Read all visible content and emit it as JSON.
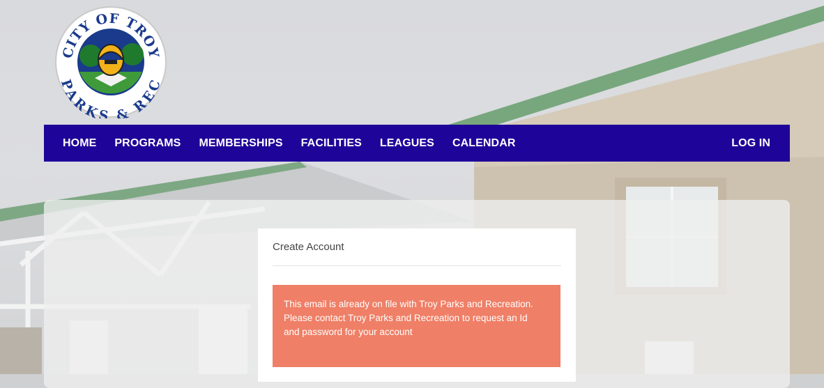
{
  "logo": {
    "top_text": "CITY OF TROY",
    "bottom_text": "PARKS & REC"
  },
  "nav": {
    "items": [
      "HOME",
      "PROGRAMS",
      "MEMBERSHIPS",
      "FACILITIES",
      "LEAGUES",
      "CALENDAR"
    ],
    "login": "LOG IN"
  },
  "card": {
    "title": "Create Account",
    "alert": "This email is already on file with Troy Parks and Recreation. Please contact Troy Parks and Recreation to request an Id and password for your account"
  },
  "colors": {
    "nav_bg": "#1f0499",
    "alert_bg": "#ef7f66",
    "roof_trim": "#78a77d"
  }
}
